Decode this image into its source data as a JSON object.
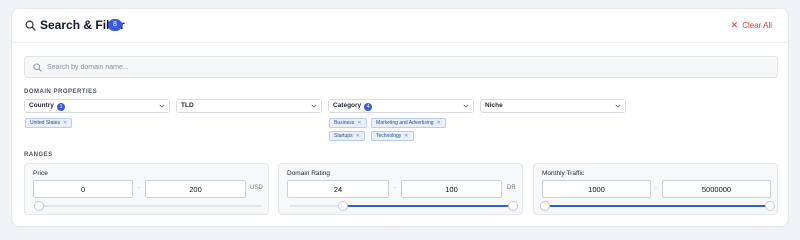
{
  "header": {
    "title": "Search & Filter",
    "active_count": "8",
    "clear_label": "Clear All",
    "clear_icon": "close-icon",
    "accent_color": "#3b5bdb",
    "danger_color": "#d43a3a"
  },
  "search": {
    "placeholder": "Search by domain name...",
    "value": ""
  },
  "domain_properties": {
    "section_label": "DOMAIN PROPERTIES",
    "filters": [
      {
        "label": "Country",
        "count": "1",
        "chips": [
          "United States"
        ]
      },
      {
        "label": "TLD",
        "count": "",
        "chips": []
      },
      {
        "label": "Category",
        "count": "4",
        "chips": [
          "Business",
          "Marketing and Advertising",
          "Startups",
          "Technology"
        ]
      },
      {
        "label": "Niche",
        "count": "",
        "chips": []
      }
    ]
  },
  "ranges": {
    "section_label": "RANGES",
    "items": [
      {
        "label": "Price",
        "min": "0",
        "max": "200",
        "unit": "USD",
        "separator": "-",
        "selected_fraction": [
          0.0,
          0.0
        ]
      },
      {
        "label": "Domain Rating",
        "min": "24",
        "max": "100",
        "unit": "DR",
        "separator": "-",
        "selected_fraction": [
          0.24,
          1.0
        ]
      },
      {
        "label": "Monthly Traffic",
        "min": "1000",
        "max": "5000000",
        "unit": "",
        "separator": "-",
        "selected_fraction": [
          0.0,
          1.0
        ]
      }
    ]
  }
}
